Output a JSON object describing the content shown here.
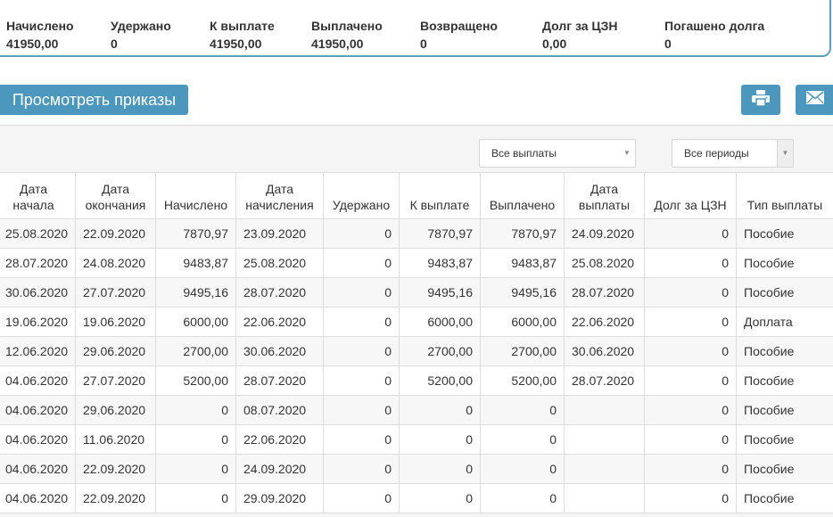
{
  "summary": {
    "accrued_label": "Начислено",
    "accrued_value": "41950,00",
    "withheld_label": "Удержано",
    "withheld_value": "0",
    "payable_label": "К выплате",
    "payable_value": "41950,00",
    "paid_label": "Выплачено",
    "paid_value": "41950,00",
    "returned_label": "Возвращено",
    "returned_value": "0",
    "debt_label": "Долг за ЦЗН",
    "debt_value": "0,00",
    "repaid_label": "Погашено долга",
    "repaid_value": "0"
  },
  "toolbar": {
    "view_orders_label": "Просмотреть приказы",
    "print_icon": "print-icon",
    "mail_icon": "envelope-icon",
    "accent_color": "#4c97bd"
  },
  "filters": {
    "payments_selected": "Все выплаты",
    "periods_selected": "Все периоды"
  },
  "table": {
    "headers": [
      [
        "Дата",
        "начала"
      ],
      [
        "Дата",
        "окончания"
      ],
      [
        "Начислено"
      ],
      [
        "Дата",
        "начисления"
      ],
      [
        "Удержано"
      ],
      [
        "К выплате"
      ],
      [
        "Выплачено"
      ],
      [
        "Дата",
        "выплаты"
      ],
      [
        "Долг за ЦЗН"
      ],
      [
        "Тип выплаты"
      ]
    ],
    "rows": [
      [
        "25.08.2020",
        "22.09.2020",
        "7870,97",
        "23.09.2020",
        "0",
        "7870,97",
        "7870,97",
        "24.09.2020",
        "0",
        "Пособие"
      ],
      [
        "28.07.2020",
        "24.08.2020",
        "9483,87",
        "25.08.2020",
        "0",
        "9483,87",
        "9483,87",
        "25.08.2020",
        "0",
        "Пособие"
      ],
      [
        "30.06.2020",
        "27.07.2020",
        "9495,16",
        "28.07.2020",
        "0",
        "9495,16",
        "9495,16",
        "28.07.2020",
        "0",
        "Пособие"
      ],
      [
        "19.06.2020",
        "19.06.2020",
        "6000,00",
        "22.06.2020",
        "0",
        "6000,00",
        "6000,00",
        "22.06.2020",
        "0",
        "Доплата"
      ],
      [
        "12.06.2020",
        "29.06.2020",
        "2700,00",
        "30.06.2020",
        "0",
        "2700,00",
        "2700,00",
        "30.06.2020",
        "0",
        "Пособие"
      ],
      [
        "04.06.2020",
        "27.07.2020",
        "5200,00",
        "28.07.2020",
        "0",
        "5200,00",
        "5200,00",
        "28.07.2020",
        "0",
        "Пособие"
      ],
      [
        "04.06.2020",
        "29.06.2020",
        "0",
        "08.07.2020",
        "0",
        "0",
        "0",
        "",
        "0",
        "Пособие"
      ],
      [
        "04.06.2020",
        "11.06.2020",
        "0",
        "22.06.2020",
        "0",
        "0",
        "0",
        "",
        "0",
        "Пособие"
      ],
      [
        "04.06.2020",
        "22.09.2020",
        "0",
        "24.09.2020",
        "0",
        "0",
        "0",
        "",
        "0",
        "Пособие"
      ],
      [
        "04.06.2020",
        "22.09.2020",
        "0",
        "29.09.2020",
        "0",
        "0",
        "0",
        "",
        "0",
        "Пособие"
      ]
    ]
  }
}
